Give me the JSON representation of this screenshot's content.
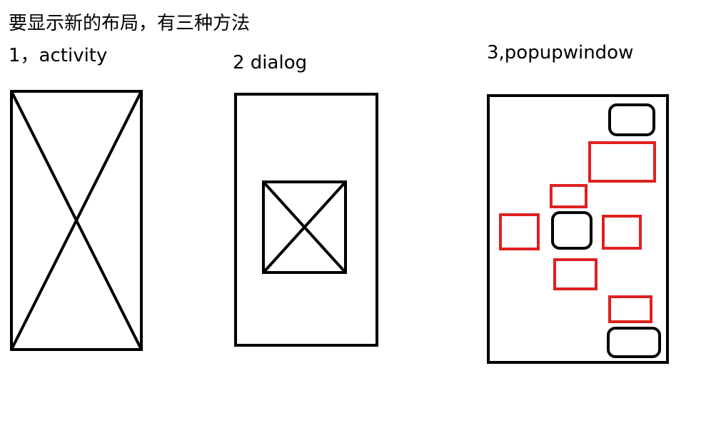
{
  "title": "要显示新的布局，有三种方法",
  "methods": [
    {
      "label": "1，activity"
    },
    {
      "label": "2 dialog"
    },
    {
      "label": "3,popupwindow"
    }
  ],
  "colors": {
    "stroke": "#000000",
    "popup": "#e02020"
  }
}
